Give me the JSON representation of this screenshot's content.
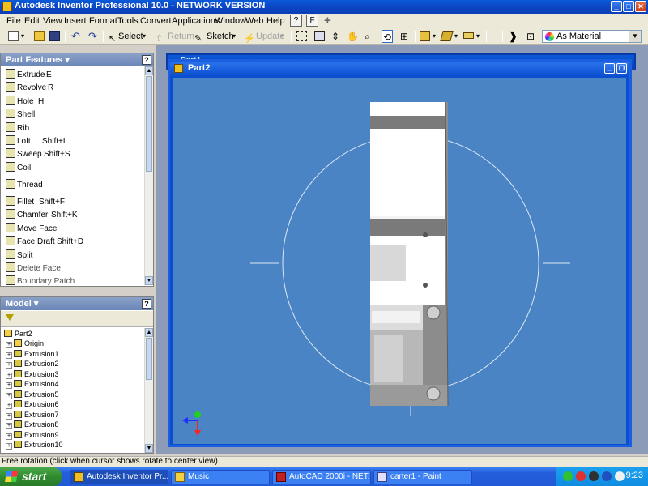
{
  "window": {
    "title": "Autodesk Inventor Professional 10.0 - NETWORK VERSION"
  },
  "menu": [
    "File",
    "Edit",
    "View",
    "Insert",
    "Format",
    "Tools",
    "Convert",
    "Applications",
    "Window",
    "Web",
    "Help"
  ],
  "toolbar": {
    "select_label": "Select",
    "return_label": "Return",
    "sketch_label": "Sketch",
    "update_label": "Update",
    "material_value": "As Material"
  },
  "part_features": {
    "title": "Part Features",
    "items": [
      {
        "label": "Extrude",
        "shortcut": "E"
      },
      {
        "label": "Revolve",
        "shortcut": "R"
      },
      {
        "label": "Hole",
        "shortcut": "H"
      },
      {
        "label": "Shell",
        "shortcut": ""
      },
      {
        "label": "Rib",
        "shortcut": ""
      },
      {
        "label": "Loft",
        "shortcut": "Shift+L"
      },
      {
        "label": "Sweep",
        "shortcut": "Shift+S"
      },
      {
        "label": "Coil",
        "shortcut": ""
      },
      {
        "label": "Thread",
        "shortcut": ""
      },
      {
        "label": "Fillet",
        "shortcut": "Shift+F"
      },
      {
        "label": "Chamfer",
        "shortcut": "Shift+K"
      },
      {
        "label": "Move Face",
        "shortcut": ""
      },
      {
        "label": "Face Draft",
        "shortcut": "Shift+D"
      },
      {
        "label": "Split",
        "shortcut": ""
      },
      {
        "label": "Delete Face",
        "shortcut": ""
      },
      {
        "label": "Boundary Patch",
        "shortcut": ""
      }
    ]
  },
  "model": {
    "title": "Model",
    "root": "Part2",
    "items": [
      "Origin",
      "Extrusion1",
      "Extrusion2",
      "Extrusion3",
      "Extrusion4",
      "Extrusion5",
      "Extrusion6",
      "Extrusion7",
      "Extrusion8",
      "Extrusion9",
      "Extrusion10"
    ]
  },
  "document": {
    "title": "Part2",
    "back_title": "Part1"
  },
  "status": {
    "text": "Free rotation (click when cursor shows rotate to center view)"
  },
  "taskbar": {
    "start": "start",
    "tasks": [
      "Autodesk Inventor Pr...",
      "Music",
      "AutoCAD 2000i - NET...",
      "carter1 - Paint"
    ],
    "clock": "9:23"
  },
  "colors": {
    "viewport_bg": "#4a84c4",
    "titlebar": "#0b4fd0",
    "panel_header": "#7a92c0"
  }
}
